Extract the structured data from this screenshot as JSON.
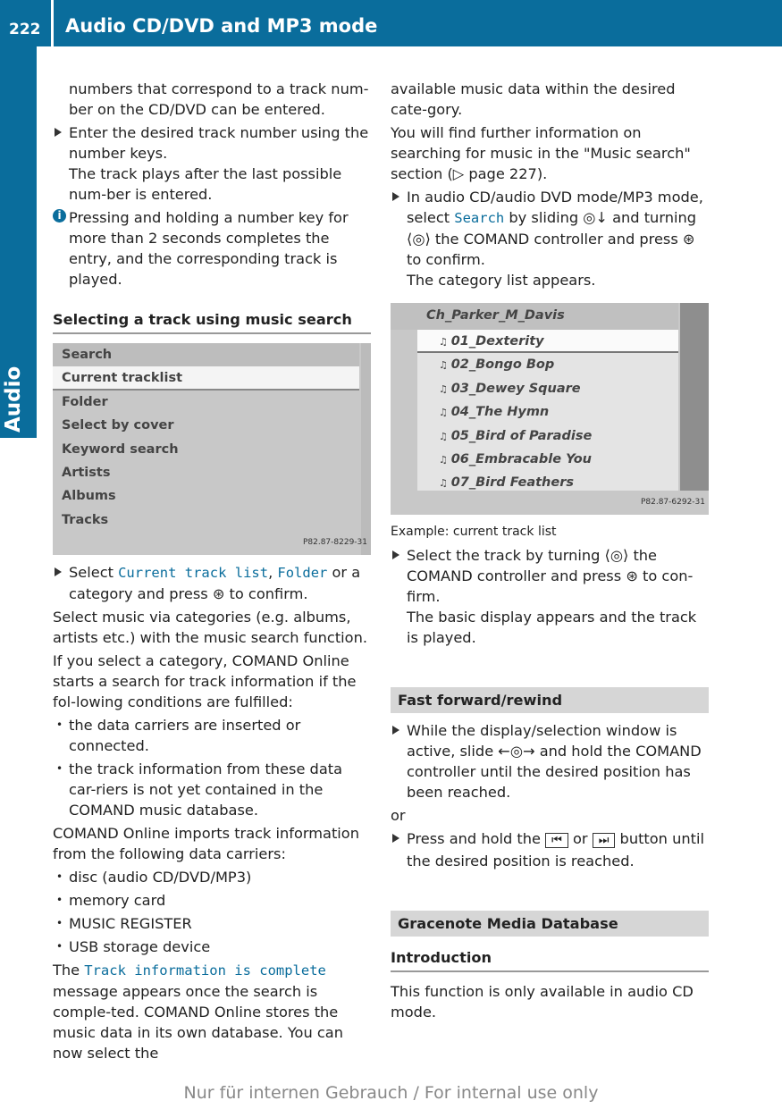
{
  "header": {
    "page_number": "222",
    "title": "Audio CD/DVD and MP3 mode"
  },
  "side_tab": "Audio",
  "left": {
    "p1": "numbers that correspond to a track num-ber on the CD/DVD can be entered.",
    "step1": "Enter the desired track number using the number keys.",
    "step1b": "The track plays after the last possible num-ber is entered.",
    "info": "Pressing and holding a number key for more than 2 seconds completes the entry, and the corresponding track is played.",
    "heading": "Selecting a track using music search",
    "screen1": {
      "items": [
        "Search",
        "Current tracklist",
        "Folder",
        "Select by cover",
        "Keyword search",
        "Artists",
        "Albums",
        "Tracks"
      ],
      "selected": 1,
      "code": "P82.87-8229-31"
    },
    "step2a": "Select ",
    "step2_code1": "Current track list",
    "step2_sep": ", ",
    "step2_code2": "Folder",
    "step2b": " or a category and press ⊛ to confirm.",
    "p2": "Select music via categories (e.g. albums, artists etc.) with the music search function.",
    "p3": "If you select a category, COMAND Online starts a search for track information if the fol-lowing conditions are fulfilled:",
    "bullets1": [
      "the data carriers are inserted or connected.",
      "the track information from these data car-riers is not yet contained in the COMAND music database."
    ],
    "p4": "COMAND Online imports track information from the following data carriers:",
    "bullets2": [
      "disc (audio CD/DVD/MP3)",
      "memory card",
      "MUSIC REGISTER",
      "USB storage device"
    ],
    "p5a": "The ",
    "p5_code": "Track information is complete",
    "p5b": " message appears once the search is comple-ted. COMAND Online stores the music data in its own database. You can now select the"
  },
  "right": {
    "p1": "available music data within the desired cate-gory.",
    "p2": "You will find further information on searching for music in the \"Music search\" section (▷ page 227).",
    "step1a": "In audio CD/audio DVD mode/MP3 mode, select ",
    "step1_code": "Search",
    "step1b": " by sliding ◎↓ and turning ⟨◎⟩ the COMAND controller and press ⊛ to confirm.",
    "step1c": "The category list appears.",
    "screen2": {
      "folder": "Ch_Parker_M_Davis",
      "items": [
        "01_Dexterity",
        "02_Bongo Bop",
        "03_Dewey Square",
        "04_The Hymn",
        "05_Bird of Paradise",
        "06_Embracable You",
        "07_Bird Feathers"
      ],
      "selected": 0,
      "code": "P82.87-6292-31"
    },
    "caption": "Example: current track list",
    "step2": "Select the track by turning ⟨◎⟩ the COMAND controller and press ⊛ to con-firm.",
    "step2b": "The basic display appears and the track is played.",
    "section1": "Fast forward/rewind",
    "step3": "While the display/selection window is active, slide ←◎→ and hold the COMAND controller until the desired position has been reached.",
    "or": "or",
    "step4a": "Press and hold the ",
    "btn1": "⏮",
    "step4or": " or ",
    "btn2": "⏭",
    "step4b": " button until the desired position is reached.",
    "section2": "Gracenote Media Database",
    "subheading": "Introduction",
    "p3": "This function is only available in audio CD mode."
  },
  "footer": "Nur für internen Gebrauch / For internal use only"
}
